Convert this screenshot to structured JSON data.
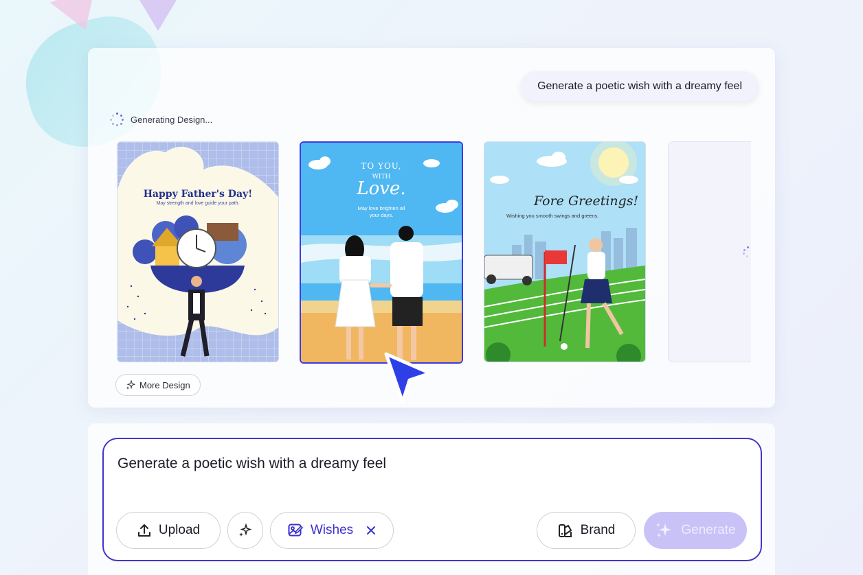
{
  "top_panel": {
    "prompt_bubble": "Generate a poetic wish with a dreamy feel",
    "status": "Generating Design...",
    "more_button": "More Design"
  },
  "cards": [
    {
      "title": "Happy Father's Day!",
      "subtitle": "May strength and love guide your path."
    },
    {
      "title_line1": "TO YOU,",
      "title_line2": "WITH",
      "title_script": "Love.",
      "subtitle_line1": "May love brighten all",
      "subtitle_line2": "your days."
    },
    {
      "title": "Fore Greetings!",
      "subtitle": "Wishing you smooth swings and greens."
    }
  ],
  "composer": {
    "input_value": "Generate a poetic wish with a dreamy feel",
    "upload_label": "Upload",
    "wishes_label": "Wishes",
    "brand_label": "Brand",
    "generate_label": "Generate"
  },
  "colors": {
    "accent": "#3b2fd1",
    "generate_bg": "#c9c2f7"
  }
}
